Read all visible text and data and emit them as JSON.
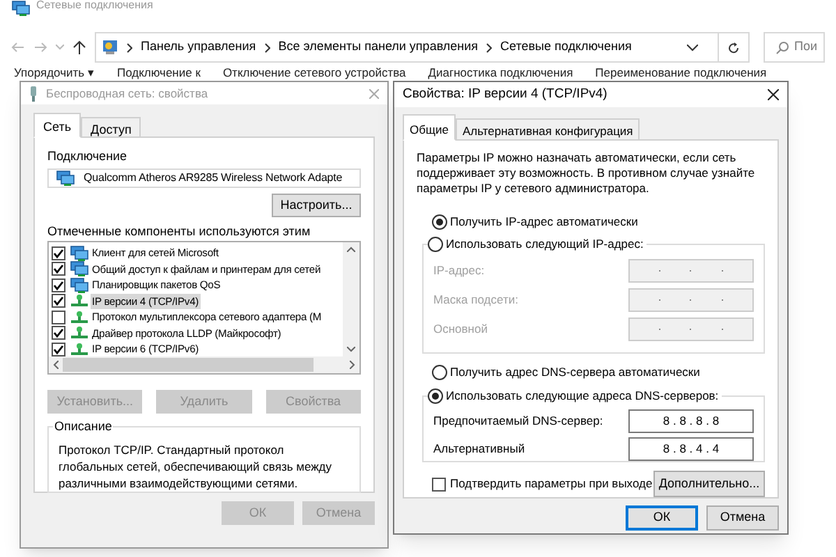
{
  "explorer": {
    "title": "Сетевые подключения",
    "breadcrumbs": [
      "Панель управления",
      "Все элементы панели управления",
      "Сетевые подключения"
    ],
    "search": {
      "placeholder": "Пои"
    },
    "toolbar": [
      "Упорядочить ▾",
      "Подключение к",
      "Отключение сетевого устройства",
      "Диагностика подключения",
      "Переименование подключения"
    ]
  },
  "wireless_dialog": {
    "title": "Беспроводная сеть: свойства",
    "tabs": [
      {
        "label": "Сеть",
        "selected": true
      },
      {
        "label": "Доступ",
        "selected": false
      }
    ],
    "connection_label": "Подключение",
    "adapter": "Qualcomm Atheros AR9285 Wireless Network Adapte",
    "configure_button": "Настроить...",
    "components_label": "Отмеченные компоненты используются этим",
    "components": [
      {
        "label": "Клиент для сетей Microsoft",
        "checked": true,
        "kind": "client",
        "selected": false
      },
      {
        "label": "Общий доступ к файлам и принтерам для сетей",
        "checked": true,
        "kind": "client",
        "selected": false
      },
      {
        "label": "Планировщик пакетов QoS",
        "checked": true,
        "kind": "client",
        "selected": false
      },
      {
        "label": "IP версии 4 (TCP/IPv4)",
        "checked": true,
        "kind": "protocol",
        "selected": true
      },
      {
        "label": "Протокол мультиплексора сетевого адаптера (М",
        "checked": false,
        "kind": "protocol",
        "selected": false
      },
      {
        "label": "Драйвер протокола LLDP (Майкрософт)",
        "checked": true,
        "kind": "protocol",
        "selected": false
      },
      {
        "label": "IP версии 6 (TCP/IPv6)",
        "checked": true,
        "kind": "protocol",
        "selected": false
      }
    ],
    "buttons": [
      {
        "label": "Установить...",
        "disabled": true
      },
      {
        "label": "Удалить",
        "disabled": true
      },
      {
        "label": "Свойства",
        "disabled": true
      }
    ],
    "description": {
      "title": "Описание",
      "text": "Протокол TCP/IP. Стандартный протокол глобальных сетей, обеспечивающий связь между различными взаимодействующими сетями."
    },
    "footer": [
      {
        "label": "ОК",
        "disabled": true
      },
      {
        "label": "Отмена",
        "disabled": true
      }
    ]
  },
  "ipv4_dialog": {
    "title": "Свойства: IP версии 4 (TCP/IPv4)",
    "tabs": [
      {
        "label": "Общие",
        "selected": true
      },
      {
        "label": "Альтернативная конфигурация",
        "selected": false
      }
    ],
    "intro": "Параметры IP можно назначать автоматически, если сеть поддерживает эту возможность. В противном случае узнайте параметры IP у сетевого администратора.",
    "ip_options": [
      {
        "label": "Получить IP-адрес автоматически",
        "selected": true
      },
      {
        "label": "Использовать следующий IP-адрес:",
        "selected": false
      }
    ],
    "ip_fields": [
      {
        "label": "IP-адрес:",
        "disabled": true
      },
      {
        "label": "Маска подсети:",
        "disabled": true
      },
      {
        "label": "Основной",
        "disabled": true
      }
    ],
    "dns_options": [
      {
        "label": "Получить адрес DNS-сервера автоматически",
        "selected": false
      },
      {
        "label": "Использовать следующие адреса DNS-серверов:",
        "selected": true
      }
    ],
    "dns_fields": [
      {
        "label": "Предпочитаемый DNS-сервер:",
        "value": "8 . 8 . 8 . 8",
        "disabled": false
      },
      {
        "label": "Альтернативный",
        "value": "8 . 8 . 4 . 4",
        "disabled": false
      }
    ],
    "validate": {
      "label": "Подтвердить параметры при выходе",
      "checked": false
    },
    "advanced_button": "Дополнительно...",
    "footer": [
      {
        "label": "ОК",
        "disabled": false,
        "default": true
      },
      {
        "label": "Отмена",
        "disabled": false,
        "default": false
      }
    ]
  }
}
